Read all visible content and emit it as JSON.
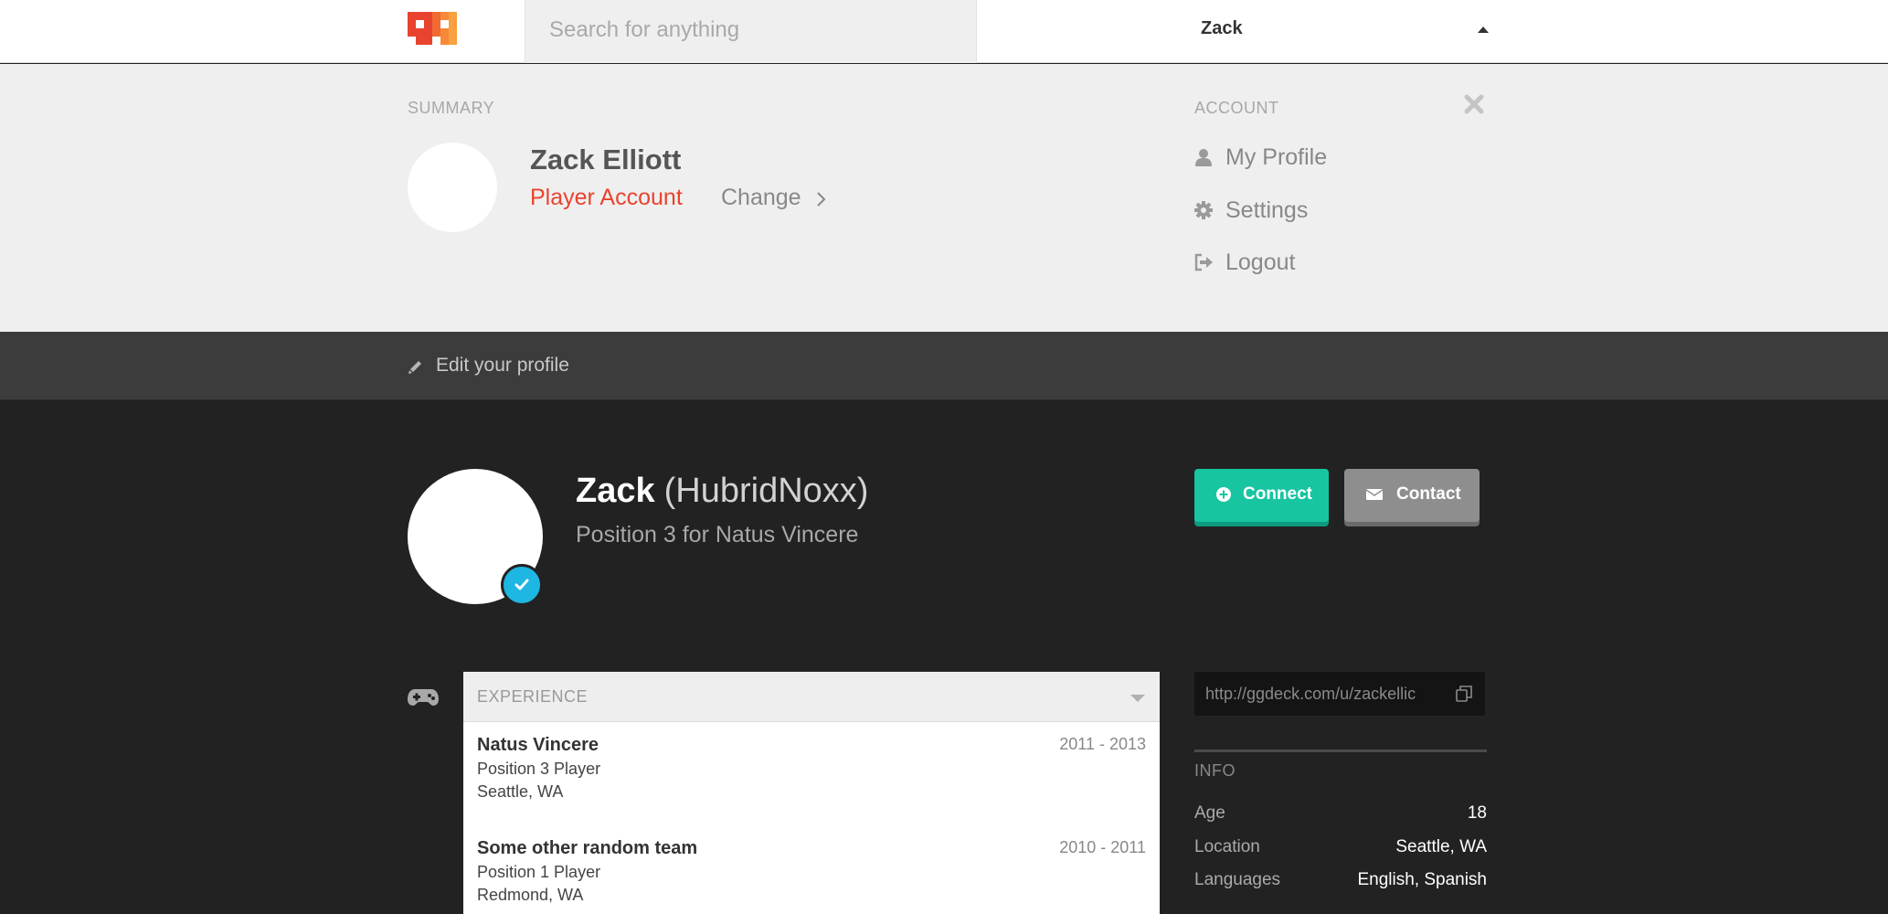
{
  "brand": {
    "logo_icon": "gg-logo-icon",
    "accent": "#e8432f"
  },
  "topbar": {
    "search_placeholder": "Search for anything",
    "user_name": "Zack"
  },
  "summary": {
    "label": "SUMMARY",
    "name": "Zack Elliott",
    "account_type": "Player Account",
    "change_label": "Change"
  },
  "account": {
    "label": "ACCOUNT",
    "items": [
      {
        "label": "My Profile",
        "icon": "user-icon"
      },
      {
        "label": "Settings",
        "icon": "gear-icon"
      },
      {
        "label": "Logout",
        "icon": "logout-icon"
      }
    ]
  },
  "edit_bar": {
    "label": "Edit your profile",
    "icon": "pencil-icon"
  },
  "profile": {
    "first_name": "Zack",
    "handle": "(HubridNoxx)",
    "subtitle": "Position 3 for Natus Vincere",
    "verified": true
  },
  "actions": {
    "connect_label": "Connect",
    "contact_label": "Contact",
    "connect_color": "#17c5a0",
    "contact_color": "#8e8e8e"
  },
  "experience": {
    "label": "EXPERIENCE",
    "entries": [
      {
        "team": "Natus Vincere",
        "role": "Position 3 Player",
        "location": "Seattle, WA",
        "dates": "2011 - 2013"
      },
      {
        "team": "Some other random team",
        "role": "Position 1 Player",
        "location": "Redmond, WA",
        "dates": "2010 - 2011"
      }
    ]
  },
  "sidebar": {
    "profile_url": "http://ggdeck.com/u/zackellic",
    "info_label": "INFO",
    "info": [
      {
        "key": "Age",
        "value": "18"
      },
      {
        "key": "Location",
        "value": "Seattle, WA"
      },
      {
        "key": "Languages",
        "value": "English, Spanish"
      }
    ]
  }
}
